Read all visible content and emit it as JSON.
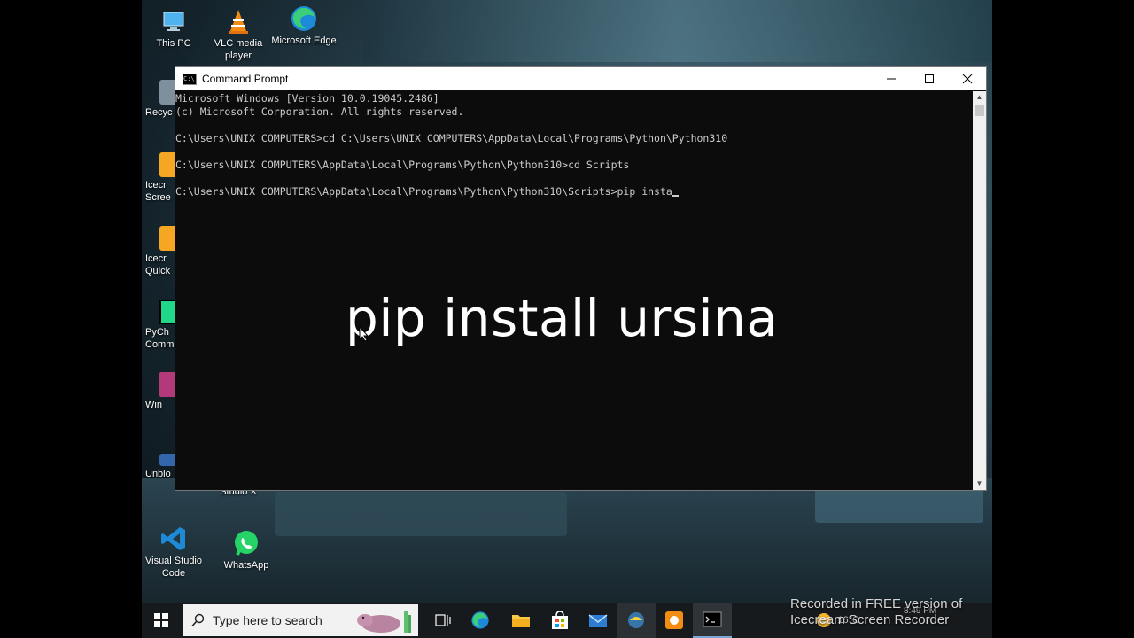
{
  "desktop": {
    "icons": [
      {
        "label": "This PC"
      },
      {
        "label": "VLC media player"
      },
      {
        "label": "Microsoft Edge"
      },
      {
        "label": "Recyc"
      },
      {
        "label": "Icecr Scree"
      },
      {
        "label": "Icecr Quick"
      },
      {
        "label": "PyCh Comm"
      },
      {
        "label": "Win"
      },
      {
        "label": "Unblo"
      },
      {
        "label": "Studio X"
      },
      {
        "label": "Visual Studio Code"
      },
      {
        "label": "WhatsApp"
      }
    ]
  },
  "cmd_window": {
    "title": "Command Prompt",
    "lines": [
      "Microsoft Windows [Version 10.0.19045.2486]",
      "(c) Microsoft Corporation. All rights reserved.",
      "",
      "C:\\Users\\UNIX COMPUTERS>cd C:\\Users\\UNIX COMPUTERS\\AppData\\Local\\Programs\\Python\\Python310",
      "",
      "C:\\Users\\UNIX COMPUTERS\\AppData\\Local\\Programs\\Python\\Python310>cd Scripts",
      "",
      "C:\\Users\\UNIX COMPUTERS\\AppData\\Local\\Programs\\Python\\Python310\\Scripts>pip insta"
    ]
  },
  "overlay_text": "pip install ursina",
  "taskbar": {
    "search_placeholder": "Type here to search",
    "tray_temp": "16°C",
    "clock_time": "8:49 PM"
  },
  "watermark": {
    "line1": "Recorded in FREE version of",
    "line2": "Icecream Screen Recorder"
  },
  "colors": {
    "console_bg": "#0c0c0c",
    "console_text": "#cccccc",
    "taskbar_bg": "#171a1c"
  }
}
